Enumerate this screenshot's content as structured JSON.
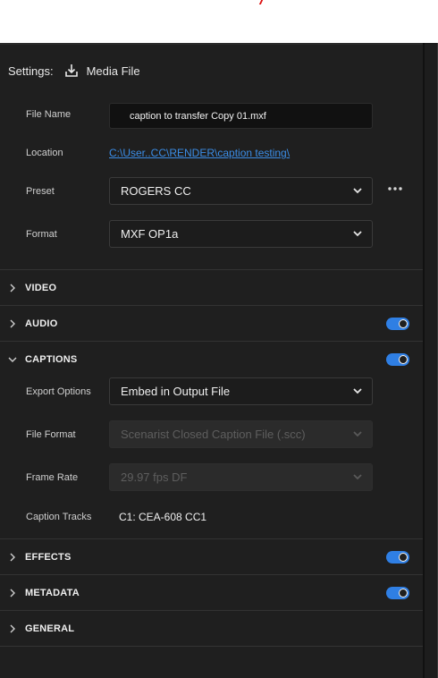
{
  "settings": {
    "label": "Settings:",
    "mode": "Media File"
  },
  "fields": {
    "file_name": {
      "label": "File Name",
      "value": "caption to transfer Copy 01.mxf"
    },
    "location": {
      "label": "Location",
      "value": "C:\\User..CC\\RENDER\\caption testing\\"
    },
    "preset": {
      "label": "Preset",
      "value": "ROGERS CC"
    },
    "format": {
      "label": "Format",
      "value": "MXF OP1a"
    }
  },
  "sections": {
    "video": {
      "title": "VIDEO"
    },
    "audio": {
      "title": "AUDIO",
      "enabled": true
    },
    "captions": {
      "title": "CAPTIONS",
      "enabled": true
    },
    "effects": {
      "title": "EFFECTS",
      "enabled": true
    },
    "metadata": {
      "title": "METADATA",
      "enabled": true
    },
    "general": {
      "title": "GENERAL"
    }
  },
  "captions": {
    "export_options": {
      "label": "Export Options",
      "value": "Embed in Output File"
    },
    "file_format": {
      "label": "File Format",
      "value": "Scenarist Closed Caption File (.scc)"
    },
    "frame_rate": {
      "label": "Frame Rate",
      "value": "29.97 fps DF"
    },
    "caption_tracks": {
      "label": "Caption Tracks",
      "value": "C1: CEA-608 CC1"
    }
  },
  "colors": {
    "accent": "#2f7fe4",
    "link": "#3b8de6",
    "panel_bg": "#1f1f1f"
  },
  "icons": {
    "settings_icon": "download-to-tray-icon",
    "dropdown": "chevron-down-icon",
    "collapsed": "chevron-right-icon",
    "expanded": "chevron-down-icon",
    "more": "more-horizontal-icon"
  }
}
